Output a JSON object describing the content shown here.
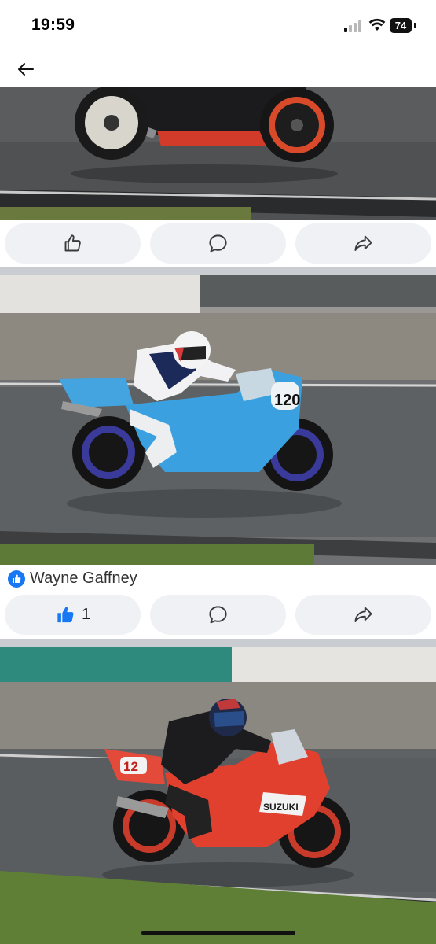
{
  "status_bar": {
    "time": "19:59",
    "battery": "74",
    "signal_icon": "cellular-signal-icon",
    "wifi_icon": "wifi-icon"
  },
  "nav": {
    "back_icon": "arrow-left-icon"
  },
  "posts": [
    {
      "photo": "red-black-motorbike-on-wet-track",
      "actions": {
        "like_icon": "thumbs-up-outline-icon",
        "comment_icon": "comment-bubble-icon",
        "share_icon": "share-arrow-icon"
      }
    },
    {
      "photo": "blue-motorbike-rider-number-120",
      "reaction": {
        "icon": "like-reaction-icon",
        "name": "Wayne Gaffney"
      },
      "actions": {
        "like_icon": "thumbs-up-filled-icon",
        "like_count": "1",
        "comment_icon": "comment-bubble-icon",
        "share_icon": "share-arrow-icon"
      }
    },
    {
      "photo": "red-suzuki-motorbike-number-12",
      "actions": {}
    }
  ],
  "colors": {
    "accent": "#1877f2",
    "pill_bg": "#eff1f4",
    "divider": "#c9ccd1"
  }
}
